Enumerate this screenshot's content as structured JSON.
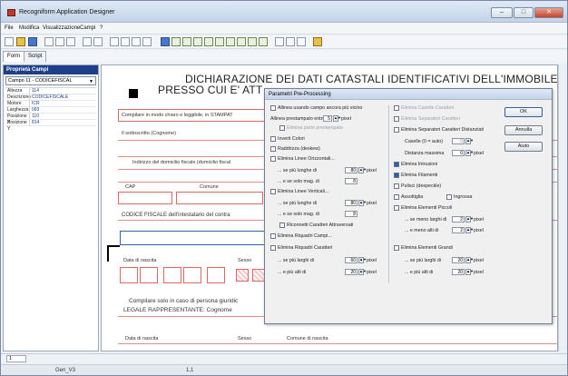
{
  "window": {
    "title": "Recogniform Application Designer",
    "buttons": [
      "–",
      "□",
      "✕"
    ]
  },
  "menu": [
    "File",
    "Modifica",
    "Visualizzazione",
    "Campi",
    "?"
  ],
  "tabs": [
    "Form",
    "Script"
  ],
  "left_panel": {
    "header": "Proprietà Campi",
    "field_select": "Campo 11 - CODICEFISCAL",
    "properties": [
      {
        "k": "Altezza",
        "v": "114"
      },
      {
        "k": "Descrizione",
        "v": "CODICEFISCALE"
      },
      {
        "k": "Motore",
        "v": "ICR"
      },
      {
        "k": "Larghezza",
        "v": "993"
      },
      {
        "k": "Posizione X",
        "v": "110"
      },
      {
        "k": "Posizione Y",
        "v": "814"
      }
    ]
  },
  "form": {
    "title1": "DICHIARAZIONE DEI DATI CATASTALI IDENTIFICATIVI DELL'IMMOBILE",
    "title2": "PRESSO CUI E' ATT",
    "instr": "Compilare in modo chiaro e leggibile, in STAMPAT",
    "sottoscritto": "Il sottoscritto (Cognome)",
    "indirizzo": "Indirizzo del domicilio fiscale (domicilio fiscal",
    "cap": "CAP",
    "comune": "Comune",
    "cf": "CODICE FISCALE dell'intestatario del contra",
    "data_nascita": "Data di nascita",
    "sesso": "Sesso",
    "giuridica": "Compilare solo in caso di persona giuridic",
    "legale": "LEGALE RAPPRESENTANTE: Cognome",
    "data_nascita2": "Data di nascita",
    "sesso2": "Sesso",
    "comune_nascita": "Comune di nascita"
  },
  "dialog": {
    "title": "Parametri Pre-Processing",
    "buttons": {
      "ok": "OK",
      "cancel": "Annulla",
      "help": "Aiuto"
    },
    "c1": {
      "allinea_campo": "Allinea usando campo ancora più vicino",
      "allinea_entro": "Allinea prestampato entro",
      "allinea_val": "5",
      "elimina_prestampata": "Elimina parte prestampata",
      "inverti": "Inverti Colori",
      "raddrizza": "Raddrizza (deskew)",
      "linee_orizz": "Elimina Linee Orizzontali...",
      "se_piu_lunghe": "... se più lunghe di",
      "val_80a": "80",
      "se_spesse": "... e se solo mag. di",
      "val_8a": "8",
      "linee_vert": "Elimina Linee Verticali...",
      "se_piu_lunghe2": "... se più lunghe di",
      "val_80b": "80",
      "se_spesse2": "... e se solo mag. di",
      "val_8b": "8",
      "riconnetti": "Riconnetti Caratteri Attraversati",
      "riquadri_campi": "Elimina Riquadri Campi...",
      "riquadri_car": "Elimina Riquadri Caratteri",
      "se_larghi": "... se più larghi di",
      "val_60": "60",
      "se_alti": "... e più alti di",
      "val_20": "20",
      "pixel": "pixel"
    },
    "c2": {
      "caselle_car": "Elimina Caselle Caratteri",
      "separatori": "Elimina Separatori Caratteri",
      "separatori_dist": "Elimina Separatori Caratteri Distanziati",
      "caselle_auto": "Caselle (0 = auto)",
      "val_0": "0",
      "distanza": "Distanza massima",
      "val_0b": "0",
      "intrusioni": "Elimina Intrusioni",
      "filamenti": "Elimina Filamenti",
      "pulisci": "Pulisci (despeckle)",
      "assottiglia": "Assottiglia",
      "ingrossa": "Ingrossa",
      "elem_piccoli": "Elimina Elementi Piccoli",
      "se_meno_larghi": "... se meno larghi di",
      "val_2a": "2",
      "meno_alti": "... e meno alti di",
      "val_2b": "2",
      "elem_grandi": "Elimina Elementi Grandi",
      "se_piu_larghi": "... se più larghi di",
      "val_20a": "20",
      "piu_alti": "... e più alti di",
      "val_20b": "20",
      "pixel": "pixel"
    }
  },
  "status": {
    "page": "1",
    "left": "Gen_V3",
    "coords": "1,1"
  }
}
